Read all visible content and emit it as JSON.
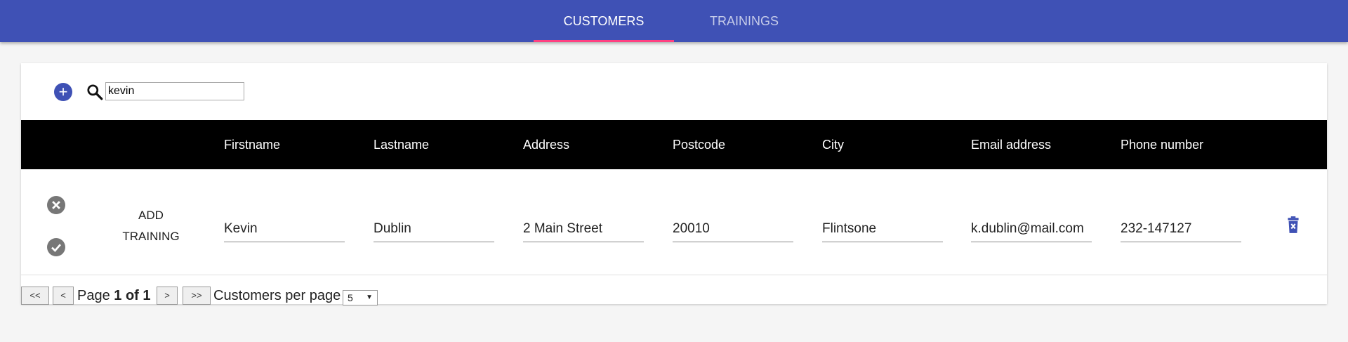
{
  "tabs": [
    {
      "label": "CUSTOMERS",
      "active": true
    },
    {
      "label": "TRAININGS",
      "active": false
    }
  ],
  "toolbar": {
    "add_icon": "add-circle-icon",
    "search_icon": "search-icon",
    "search_value": "kevin"
  },
  "table": {
    "columns": [
      "Firstname",
      "Lastname",
      "Address",
      "Postcode",
      "City",
      "Email address",
      "Phone number"
    ],
    "rows": [
      {
        "add_training_label": "ADD TRAINING",
        "add_training_line1": "ADD",
        "add_training_line2": "TRAINING",
        "firstname": "Kevin",
        "lastname": "Dublin",
        "address": "2 Main Street",
        "postcode": "20010",
        "city": "Flintsone",
        "email": "k.dublin@mail.com",
        "phone": "232-147127"
      }
    ]
  },
  "pagination": {
    "first": "<<",
    "prev": "<",
    "next": ">",
    "last": ">>",
    "page_prefix": "Page",
    "page_current": "1 of 1",
    "per_page_label": "Customers per page",
    "per_page_value": "5"
  },
  "colors": {
    "appbar": "#3f51b5",
    "tab_indicator": "#ff4081",
    "header_bg": "#000000"
  }
}
